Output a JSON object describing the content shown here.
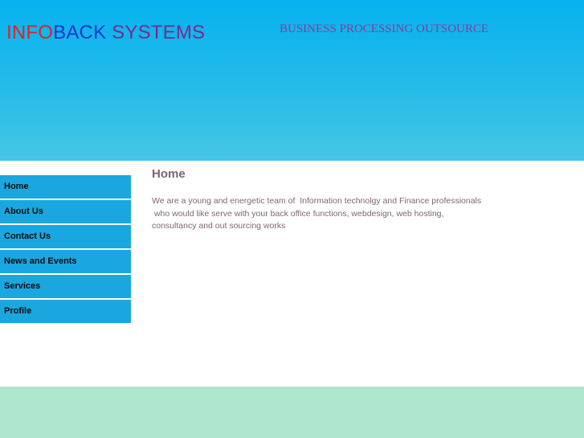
{
  "header": {
    "logo": {
      "part1": "INFO",
      "part2": "BACK",
      "part3": " SYSTEMS"
    },
    "tagline": "BUSINESS PROCESSING OUTSOURCE"
  },
  "nav": {
    "items": [
      {
        "label": "Home"
      },
      {
        "label": "About Us"
      },
      {
        "label": "Contact Us"
      },
      {
        "label": "News and Events"
      },
      {
        "label": "Services"
      },
      {
        "label": "Profile"
      }
    ]
  },
  "content": {
    "title": "Home",
    "lines": [
      "We are a young and energetic team of  Information technolgy and Finance professionals",
      " who would like serve with your back office functions, webdesign, web hosting,",
      "consultancy and out sourcing works"
    ]
  },
  "colors": {
    "header_top": "#06b2ef",
    "header_bottom": "#45c6e3",
    "nav_bg": "#1aa7df",
    "footer_bg": "#ade6cc",
    "logo_red": "#e0222a",
    "logo_blue": "#1b35c9",
    "logo_purple": "#7a2a8f"
  }
}
